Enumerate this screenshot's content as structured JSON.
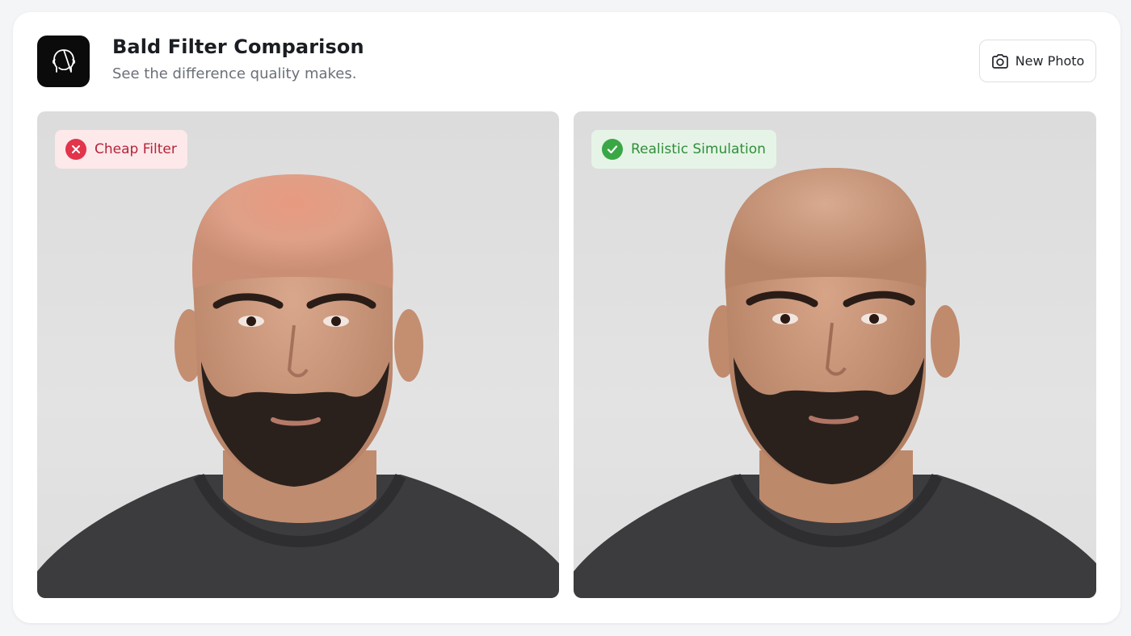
{
  "header": {
    "title": "Bald Filter Comparison",
    "subtitle": "See the difference quality makes.",
    "app_icon": "bald-head-icon",
    "new_photo_label": "New Photo",
    "new_photo_icon": "camera-icon"
  },
  "panels": [
    {
      "badge_label": "Cheap Filter",
      "badge_icon": "x-circle-icon",
      "badge_color": "#e2344a",
      "badge_bg": "#fde8ea"
    },
    {
      "badge_label": "Realistic Simulation",
      "badge_icon": "check-circle-icon",
      "badge_color": "#3aa746",
      "badge_bg": "#e6f4e7"
    }
  ]
}
